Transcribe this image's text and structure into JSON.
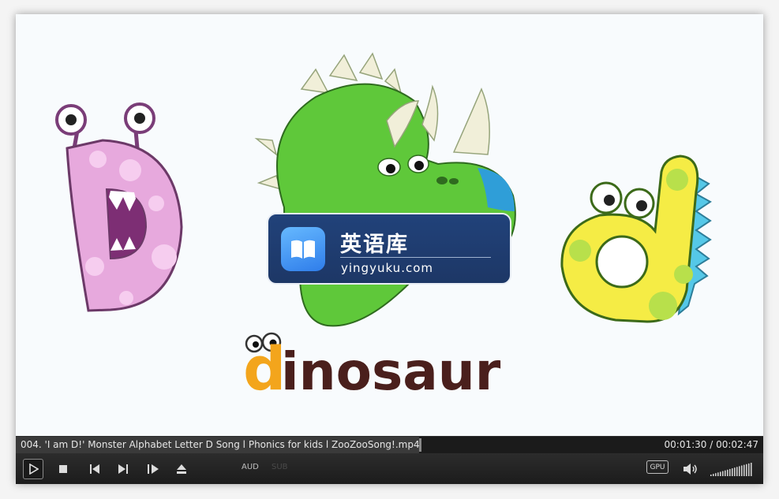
{
  "video": {
    "watermark_title": "英语库",
    "watermark_url": "yingyuku.com",
    "word_first_letter": "d",
    "word_rest": "inosaur"
  },
  "info_bar": {
    "file_title": "004. 'I am D!' Monster Alphabet Letter D Song l Phonics for kids l ZooZooSong!.mp4",
    "time_display": "00:01:30 / 00:02:47",
    "progress_fraction": 0.54
  },
  "controls": {
    "audio_label": "AUD",
    "subtitle_label": "SUB",
    "gpu_label": "GPU",
    "volume_level_fraction": 1.0
  },
  "icons": [
    "play-icon",
    "stop-icon",
    "previous-icon",
    "next-icon",
    "frame-step-icon",
    "eject-icon",
    "speaker-icon",
    "book-icon"
  ],
  "colors": {
    "info_bar_bg": "#3a3a3a",
    "controls_bg": "#1c1c1c",
    "watermark_bg": "#21427a",
    "letter_d_orange": "#f3a51c",
    "word_brown": "#4a1f1c"
  }
}
